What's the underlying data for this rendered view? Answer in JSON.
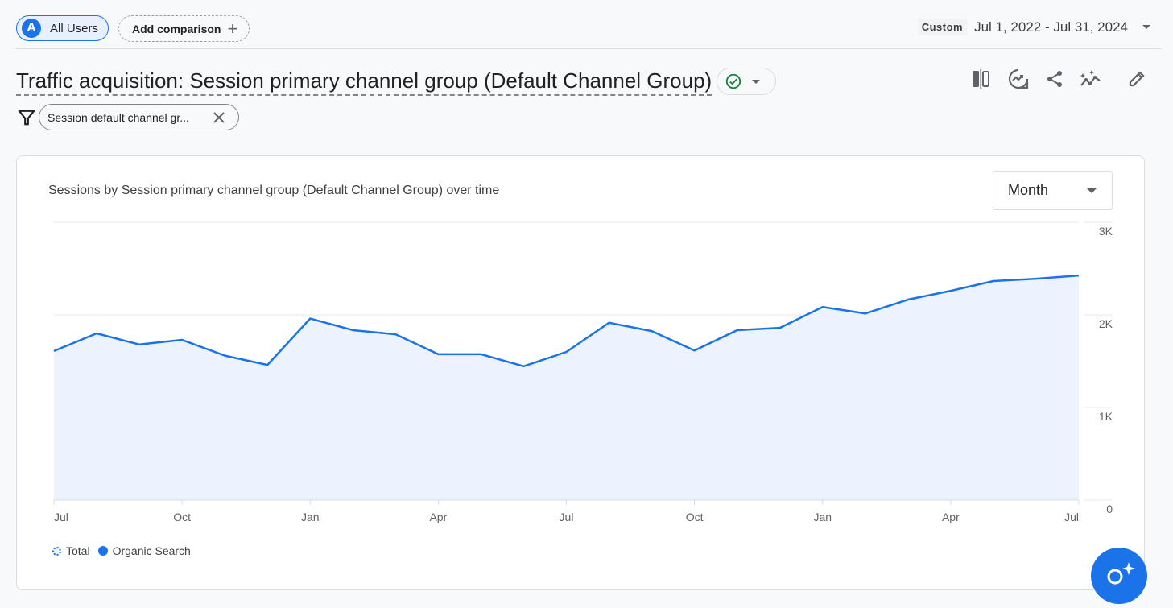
{
  "header": {
    "segment_avatar": "A",
    "segment_label": "All Users",
    "add_comparison_label": "Add comparison",
    "date_badge": "Custom",
    "date_range": "Jul 1, 2022 - Jul 31, 2024"
  },
  "page": {
    "title": "Traffic acquisition: Session primary channel group (Default Channel Group)",
    "status_icon": "check-circle-icon",
    "actions": [
      "compare-icon",
      "insights-icon",
      "share-icon",
      "sparkle-trend-icon",
      "edit-icon"
    ]
  },
  "filter": {
    "chip_label": "Session default channel gr..."
  },
  "card": {
    "granularity": "Month"
  },
  "colors": {
    "accent": "#1a73e8",
    "area_fill": "#ecf3fe",
    "grid": "#e8eaed",
    "success": "#188038"
  },
  "chart_data": {
    "type": "area",
    "title": "Sessions by Session primary channel group (Default Channel Group) over time",
    "xlabel": "",
    "ylabel": "",
    "x": [
      "Jul 2022",
      "Aug 2022",
      "Sep 2022",
      "Oct 2022",
      "Nov 2022",
      "Dec 2022",
      "Jan 2023",
      "Feb 2023",
      "Mar 2023",
      "Apr 2023",
      "May 2023",
      "Jun 2023",
      "Jul 2023",
      "Aug 2023",
      "Sep 2023",
      "Oct 2023",
      "Nov 2023",
      "Dec 2023",
      "Jan 2024",
      "Feb 2024",
      "Mar 2024",
      "Apr 2024",
      "May 2024",
      "Jun 2024",
      "Jul 2024"
    ],
    "x_tick_labels": [
      {
        "index": 0,
        "label": "Jul"
      },
      {
        "index": 3,
        "label": "Oct"
      },
      {
        "index": 6,
        "label": "Jan"
      },
      {
        "index": 9,
        "label": "Apr"
      },
      {
        "index": 12,
        "label": "Jul"
      },
      {
        "index": 15,
        "label": "Oct"
      },
      {
        "index": 18,
        "label": "Jan"
      },
      {
        "index": 21,
        "label": "Apr"
      },
      {
        "index": 24,
        "label": "Jul"
      }
    ],
    "y_ticks": [
      {
        "value": 0,
        "label": "0"
      },
      {
        "value": 1000,
        "label": "1K"
      },
      {
        "value": 2000,
        "label": "2K"
      },
      {
        "value": 3000,
        "label": "3K"
      }
    ],
    "ylim": [
      0,
      3000
    ],
    "grid": true,
    "legend_position": "bottom-left",
    "series": [
      {
        "name": "Total",
        "values": []
      },
      {
        "name": "Organic Search",
        "values": [
          1610,
          1800,
          1680,
          1730,
          1560,
          1460,
          1960,
          1835,
          1790,
          1575,
          1575,
          1445,
          1600,
          1915,
          1825,
          1615,
          1835,
          1860,
          2085,
          2015,
          2165,
          2260,
          2365,
          2390,
          2425
        ]
      }
    ]
  }
}
